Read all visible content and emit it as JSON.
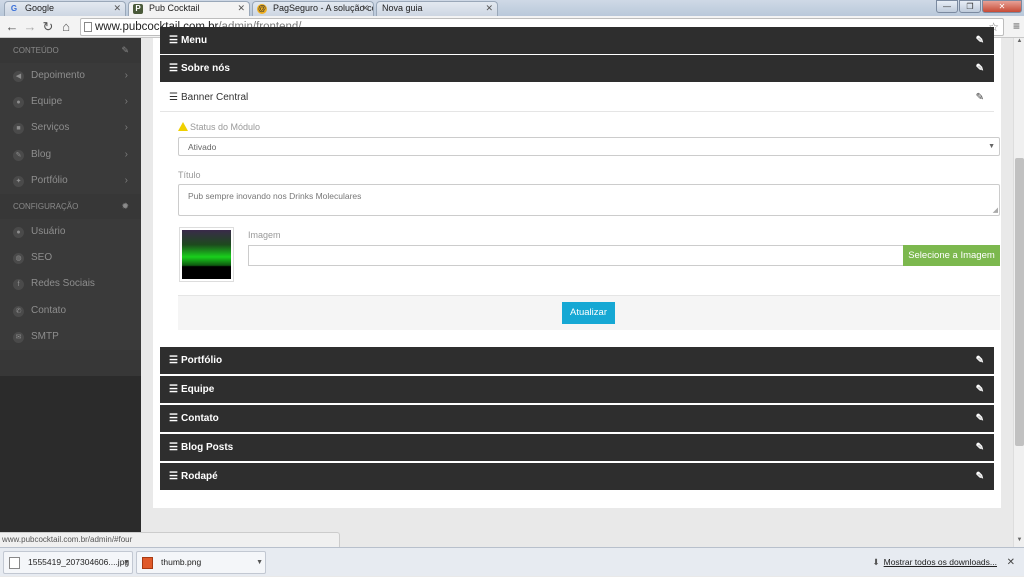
{
  "browser": {
    "tabs": [
      {
        "title": "Google",
        "icon": "G"
      },
      {
        "title": "Pub Cocktail",
        "icon": "P"
      },
      {
        "title": "PagSeguro - A solução co",
        "icon": "@"
      },
      {
        "title": "Nova guia",
        "icon": ""
      }
    ],
    "url_host": "www.pubcocktail.com.br",
    "url_path": "/admin/frontend/",
    "status_url": "www.pubcocktail.com.br/admin/#four"
  },
  "sidebar": {
    "sections": [
      {
        "title": "CONTEÚDO",
        "icon": "edit-icon",
        "items": [
          {
            "label": "Depoimento",
            "icon": "megaphone-icon"
          },
          {
            "label": "Equipe",
            "icon": "group-icon"
          },
          {
            "label": "Serviços",
            "icon": "briefcase-icon"
          },
          {
            "label": "Blog",
            "icon": "pencil-icon"
          },
          {
            "label": "Portfólio",
            "icon": "wrench-icon"
          }
        ]
      },
      {
        "title": "CONFIGURAÇÃO",
        "icon": "gear-icon",
        "items": [
          {
            "label": "Usuário",
            "icon": "user-icon"
          },
          {
            "label": "SEO",
            "icon": "globe-icon"
          },
          {
            "label": "Redes Sociais",
            "icon": "facebook-icon"
          },
          {
            "label": "Contato",
            "icon": "phone-icon"
          },
          {
            "label": "SMTP",
            "icon": "envelope-icon"
          }
        ]
      }
    ]
  },
  "main": {
    "top_panels": [
      "Menu",
      "Sobre nós"
    ],
    "open_panel": {
      "title": "Banner Central",
      "status_label": "Status do Módulo",
      "status_value": "Ativado",
      "title_label": "Título",
      "title_value": "Pub sempre inovando nos Drinks Moleculares",
      "image_label": "Imagem",
      "image_value": "",
      "select_image_label": "Selecione a Imagem",
      "update_label": "Atualizar"
    },
    "bottom_panels": [
      "Portfólio",
      "Equipe",
      "Contato",
      "Blog Posts",
      "Rodapé"
    ]
  },
  "downloads": {
    "items": [
      "1555419_207304606....jpg",
      "thumb.png"
    ],
    "show_all": "Mostrar todos os downloads..."
  },
  "colors": {
    "sidebar_bg": "#2b2b2b",
    "panel_bar": "#2e2e2e",
    "select_image_button": "#7cb84e",
    "update_button": "#16a8d4"
  }
}
